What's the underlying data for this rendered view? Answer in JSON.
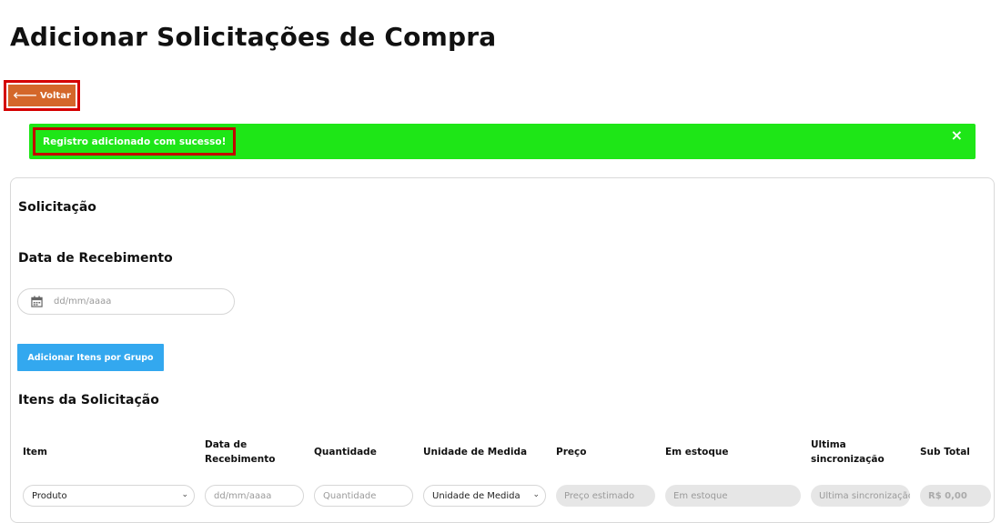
{
  "page": {
    "title": "Adicionar Solicitações de Compra"
  },
  "back_button": {
    "label": "Voltar",
    "icon": "arrow-left-icon"
  },
  "alert": {
    "message": "Registro adicionado com sucesso!",
    "close": "×",
    "color": "#1ee617"
  },
  "form": {
    "section_title": "Solicitação",
    "date_label": "Data de Recebimento",
    "date_placeholder": "dd/mm/aaaa",
    "group_button": "Adicionar Itens por Grupo",
    "items_title": "Itens da Solicitação"
  },
  "table": {
    "headers": {
      "item": "Item",
      "data1": "Data de",
      "data2": "Recebimento",
      "quantidade": "Quantidade",
      "unidade": "Unidade de Medida",
      "preco": "Preço",
      "estoque": "Em estoque",
      "sync1": "Ultima",
      "sync2": "sincronização",
      "subtotal": "Sub Total"
    },
    "row": {
      "produto": "Produto",
      "data_placeholder": "dd/mm/aaaa",
      "quantidade_placeholder": "Quantidade",
      "unidade": "Unidade de Medida",
      "preco_placeholder": "Preço estimado",
      "estoque_placeholder": "Em estoque",
      "sync_placeholder": "Ultima sincronização",
      "subtotal": "R$ 0,00"
    }
  },
  "colors": {
    "accent_orange": "#d4672a",
    "button_blue": "#33a8ef",
    "highlight_red": "#d40000"
  }
}
